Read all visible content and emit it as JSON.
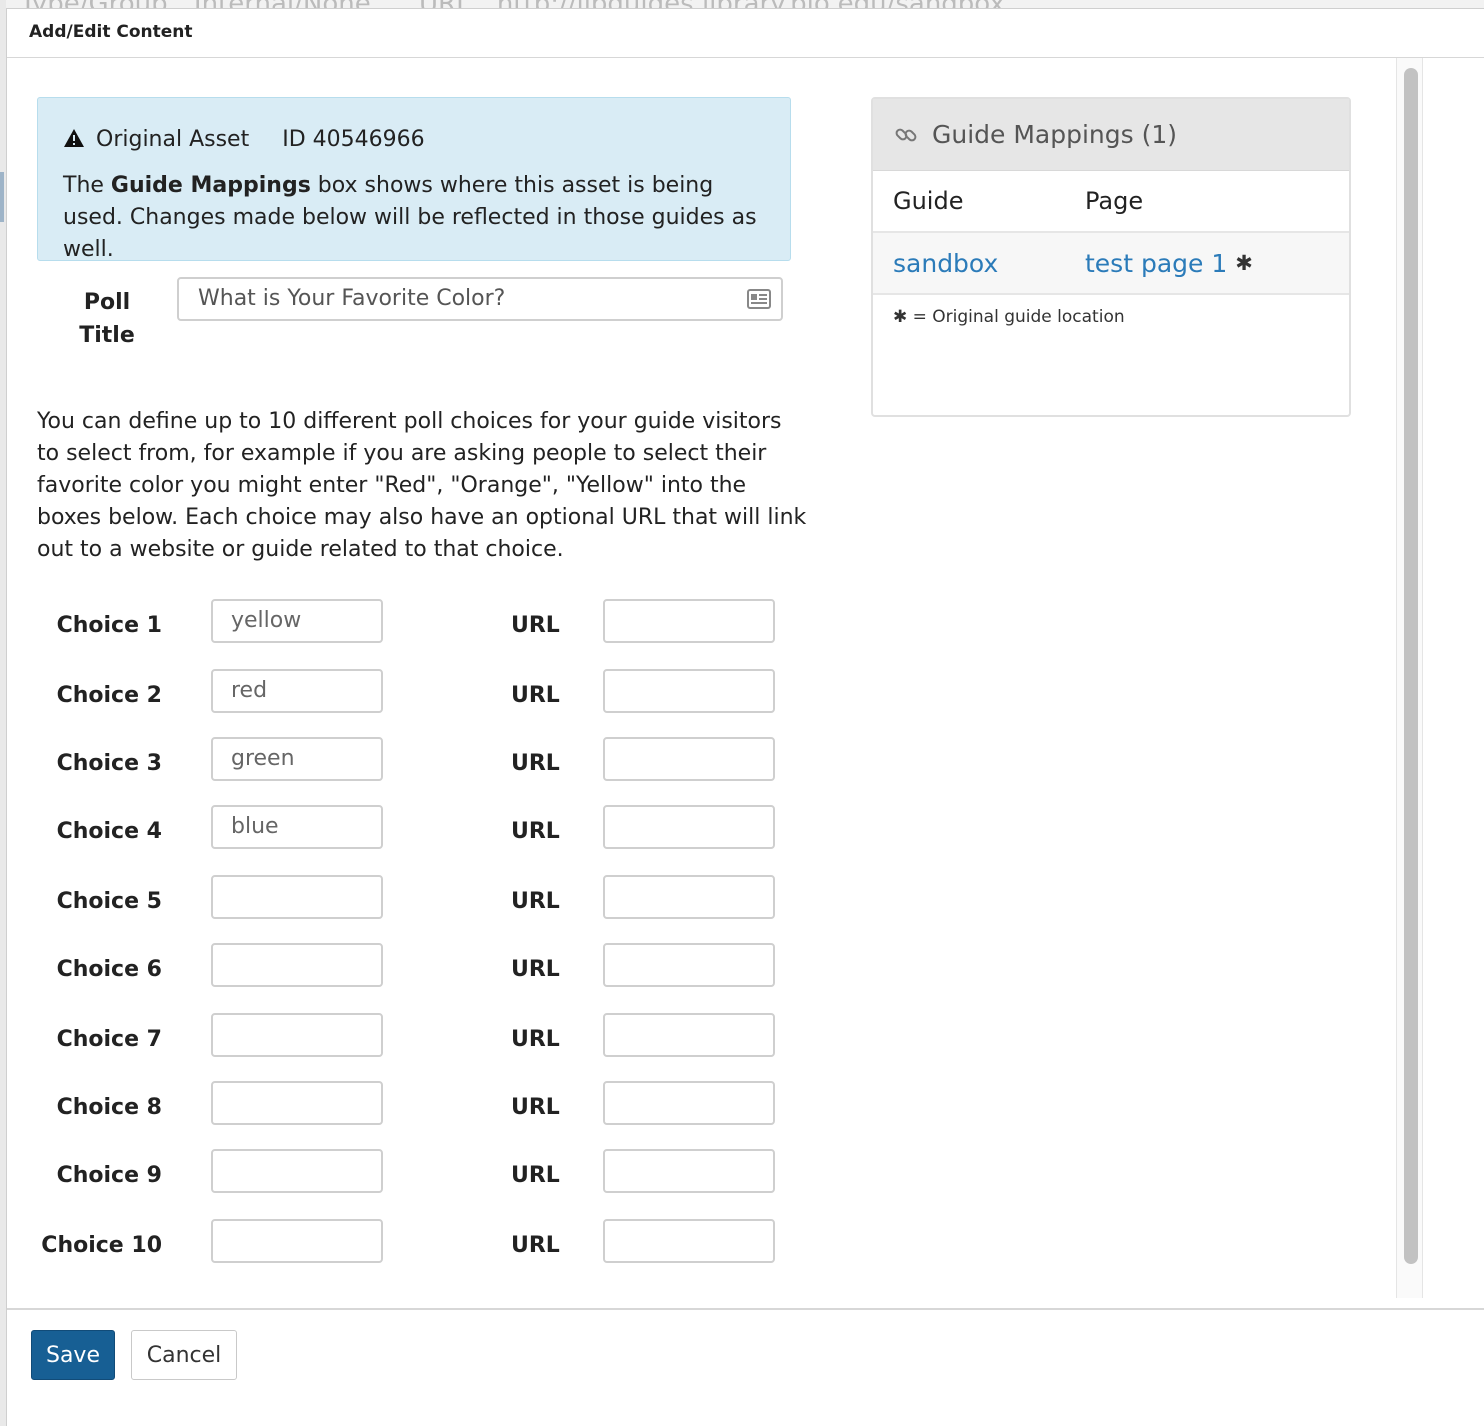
{
  "background_header": {
    "type_group_label": "Type/Group",
    "type_group_value": "Internal/None",
    "url_label": "URL",
    "url_value": "http://libguides.library.pio.edu/sandbox"
  },
  "modal": {
    "title": "Add/Edit Content"
  },
  "alert": {
    "icon": "warning-icon",
    "original_asset": "Original Asset",
    "id_text": "ID 40546966",
    "message_prefix": "The ",
    "message_bold": "Guide Mappings",
    "message_suffix": " box shows where this asset is being used. Changes made below will be reflected in those guides as well."
  },
  "poll": {
    "label": "Poll Title",
    "value": "What is Your Favorite Color?",
    "field_icon": "id-card-icon"
  },
  "help_text": "You can define up to 10 different poll choices for your guide visitors to select from, for example if you are asking people to select their favorite color you might enter \"Red\", \"Orange\", \"Yellow\" into the boxes below. Each choice may also have an optional URL that will link out to a website or guide related to that choice.",
  "choices": [
    {
      "label": "Choice 1",
      "value": "yellow",
      "url_label": "URL",
      "url_value": ""
    },
    {
      "label": "Choice 2",
      "value": "red",
      "url_label": "URL",
      "url_value": ""
    },
    {
      "label": "Choice 3",
      "value": "green",
      "url_label": "URL",
      "url_value": ""
    },
    {
      "label": "Choice 4",
      "value": "blue",
      "url_label": "URL",
      "url_value": ""
    },
    {
      "label": "Choice 5",
      "value": "",
      "url_label": "URL",
      "url_value": ""
    },
    {
      "label": "Choice 6",
      "value": "",
      "url_label": "URL",
      "url_value": ""
    },
    {
      "label": "Choice 7",
      "value": "",
      "url_label": "URL",
      "url_value": ""
    },
    {
      "label": "Choice 8",
      "value": "",
      "url_label": "URL",
      "url_value": ""
    },
    {
      "label": "Choice 9",
      "value": "",
      "url_label": "URL",
      "url_value": ""
    },
    {
      "label": "Choice 10",
      "value": "",
      "url_label": "URL",
      "url_value": ""
    }
  ],
  "guide_mappings": {
    "title": "Guide Mappings (1)",
    "icon": "link-icon",
    "headers": [
      "Guide",
      "Page"
    ],
    "rows": [
      {
        "guide": "sandbox",
        "page": "test page 1",
        "original": "✱"
      }
    ],
    "note": "✱ = Original guide location"
  },
  "footer": {
    "save_label": "Save",
    "cancel_label": "Cancel"
  },
  "colors": {
    "accent": "#175f94",
    "link": "#2b7bb9",
    "alert_bg": "#d9ecf5"
  }
}
